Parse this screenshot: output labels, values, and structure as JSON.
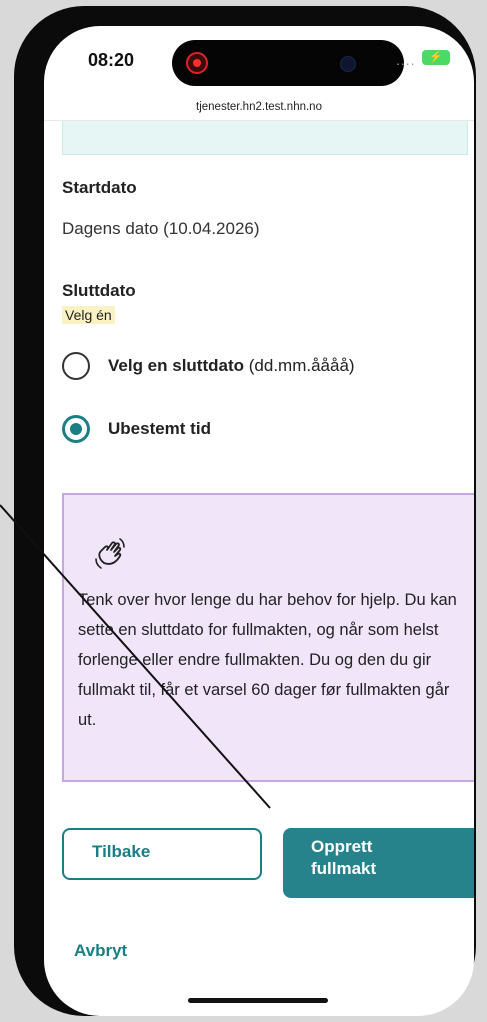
{
  "status_bar": {
    "time": "08:20",
    "signal": "....",
    "battery_symbol": "⚡"
  },
  "browser": {
    "url": "tjenester.hn2.test.nhn.no"
  },
  "start": {
    "label": "Startdato",
    "value": "Dagens dato (10.04.2026)"
  },
  "end": {
    "label": "Sluttdato",
    "hint": "Velg én",
    "options": [
      {
        "label_bold": "Velg en sluttdato",
        "label_extra": " (dd.mm.åååå)",
        "selected": false
      },
      {
        "label_bold": "Ubestemt tid",
        "label_extra": "",
        "selected": true
      }
    ]
  },
  "callout": {
    "icon": "waving-hand-icon",
    "text": "Tenk over hvor lenge du har behov for hjelp. Du kan sette en sluttdato for fullmakten, og når som helst forlenge eller endre fullmakten. Du og den du gir fullmakt til, får et varsel 60 dager før fullmakten går ut."
  },
  "buttons": {
    "back": "Tilbake",
    "create_line1": "Opprett",
    "create_line2": "fullmakt"
  },
  "cancel": "Avbryt",
  "colors": {
    "accent": "#1a7e85",
    "callout_bg": "#f1e5fa",
    "callout_border": "#c7a6e3",
    "hint_bg": "#fbf2c3"
  }
}
